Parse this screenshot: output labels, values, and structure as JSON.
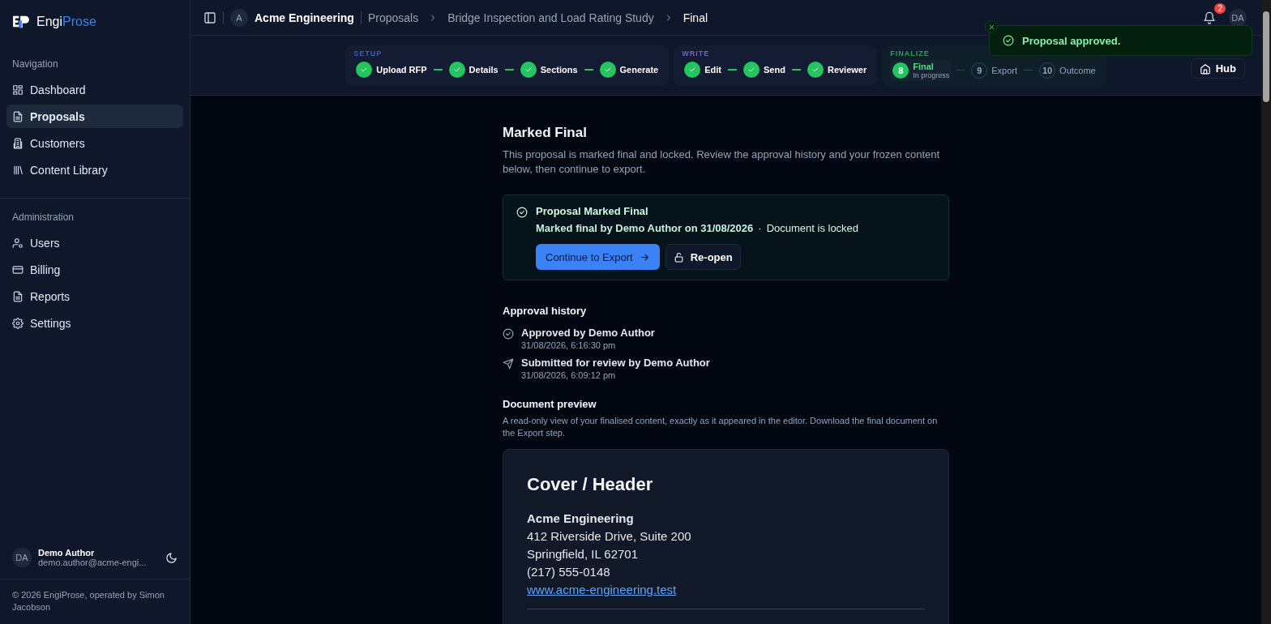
{
  "brand": {
    "name": "Engi",
    "accent": "Prose"
  },
  "sidebar": {
    "sections": [
      {
        "title": "Navigation",
        "items": [
          {
            "label": "Dashboard",
            "selected": false
          },
          {
            "label": "Proposals",
            "selected": true
          },
          {
            "label": "Customers",
            "selected": false
          },
          {
            "label": "Content Library",
            "selected": false
          }
        ]
      },
      {
        "title": "Administration",
        "items": [
          {
            "label": "Users",
            "selected": false
          },
          {
            "label": "Billing",
            "selected": false
          },
          {
            "label": "Reports",
            "selected": false
          },
          {
            "label": "Settings",
            "selected": false
          }
        ]
      }
    ],
    "user": {
      "initials": "DA",
      "name": "Demo Author",
      "email": "demo.author@acme-engi..."
    },
    "footer": "© 2026 EngiProse, operated by Simon Jacobson"
  },
  "topbar": {
    "org_initial": "A",
    "org": "Acme Engineering",
    "breadcrumbs": [
      {
        "label": "Proposals",
        "current": false
      },
      {
        "label": "Bridge Inspection and Load Rating Study",
        "current": false
      },
      {
        "label": "Final",
        "current": true
      }
    ],
    "notification_count": "2",
    "avatar": "DA"
  },
  "toast": {
    "message": "Proposal approved."
  },
  "stepper": {
    "groups": [
      {
        "label": "SETUP",
        "color": "#3b5fb8",
        "steps": [
          {
            "label": "Upload RFP",
            "completed": true,
            "current": false
          },
          {
            "label": "Details",
            "completed": true,
            "current": false
          },
          {
            "label": "Sections",
            "completed": true,
            "current": false
          },
          {
            "label": "Generate",
            "completed": true,
            "current": false
          }
        ]
      },
      {
        "label": "WRITE",
        "color": "#7b5fc0",
        "steps": [
          {
            "label": "Edit",
            "completed": true,
            "current": false
          },
          {
            "label": "Send",
            "completed": true,
            "current": false
          },
          {
            "label": "Reviewer",
            "completed": true,
            "current": false
          }
        ]
      },
      {
        "label": "FINALIZE",
        "color": "#2f9e5e",
        "steps": [
          {
            "number": "8",
            "label": "Final",
            "sublabel": "In progress",
            "completed": false,
            "current": true
          },
          {
            "number": "9",
            "label": "Export",
            "completed": false,
            "current": false
          },
          {
            "number": "10",
            "label": "Outcome",
            "completed": false,
            "current": false
          }
        ]
      }
    ],
    "hub_button": "Hub"
  },
  "main": {
    "title": "Marked Final",
    "intro": "This proposal is marked final and locked. Review the approval history and your frozen content below, then continue to export.",
    "final_card": {
      "title": "Proposal Marked Final",
      "meta": "Marked final by **Demo Author** on **31/08/2026**",
      "separator": "·",
      "status": "Document is locked",
      "primary_button": "Continue to Export",
      "secondary_button": "Re-open"
    },
    "history": {
      "title": "Approval history",
      "entries": [
        {
          "kind": "approved",
          "text": "Approved by Demo Author",
          "time": "31/08/2026, 6:16:30 pm"
        },
        {
          "kind": "submitted",
          "text": "Submitted for review by Demo Author",
          "time": "31/08/2026, 6:09:12 pm"
        }
      ]
    },
    "preview": {
      "title": "Document preview",
      "description": "A read-only view of your finalised content, exactly as it appeared in the editor. Download the final document on the Export step.",
      "heading": "Cover / Header",
      "company": "Acme Engineering",
      "lines": [
        "412 Riverside Drive, Suite 200",
        "Springfield, IL 62701",
        "(217) 555-0148"
      ],
      "link": "www.acme-engineering.test"
    }
  }
}
